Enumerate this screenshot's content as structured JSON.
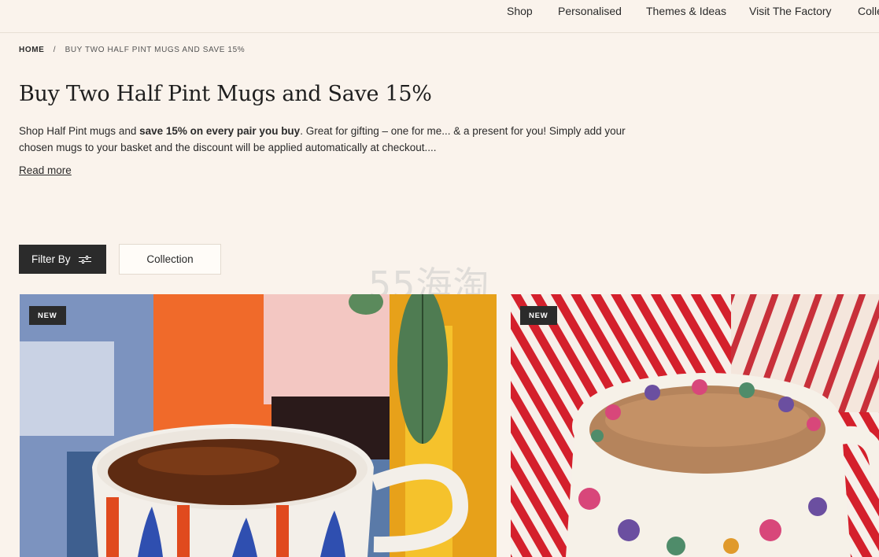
{
  "nav": {
    "items": [
      "Shop",
      "Personalised",
      "Themes & Ideas",
      "Visit The Factory",
      "Colle"
    ]
  },
  "breadcrumb": {
    "home": "HOME",
    "separator": "/",
    "current": "BUY TWO HALF PINT MUGS AND SAVE 15%"
  },
  "page": {
    "title": "Buy Two Half Pint Mugs and Save 15%",
    "intro_before": "Shop Half Pint mugs and ",
    "intro_bold": "save 15% on every pair you buy",
    "intro_after": ". Great for gifting – one for me... & a present for you! Simply add your chosen mugs to your basket and the discount will be applied automatically at checkout....",
    "read_more": "Read more"
  },
  "filters": {
    "filter_label": "Filter By",
    "filter_icon": "sliders-icon",
    "collection_label": "Collection"
  },
  "watermark": "55海淘",
  "products": [
    {
      "badge": "NEW",
      "image": "tea-mug-blue-orange-pattern-photo"
    },
    {
      "badge": "NEW",
      "image": "tea-mug-floral-pattern-red-stripes-photo"
    }
  ],
  "colors": {
    "background": "#faf3ec",
    "dark_button": "#2b2b2b",
    "text": "#2a2a2a"
  }
}
